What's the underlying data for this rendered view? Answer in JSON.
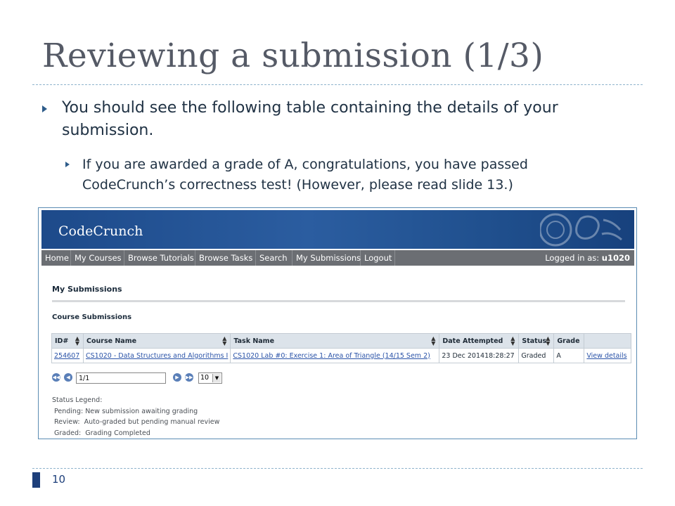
{
  "slide": {
    "title": "Reviewing a submission (1/3)",
    "bullet1": "You should see the following table containing the details of your submission.",
    "bullet2": "If you are awarded a grade of A, congratulations, you have passed CodeCrunch’s correctness test! (However, please read slide 13.)",
    "page_number": "10"
  },
  "app": {
    "logo": "CodeCrunch",
    "nav": [
      "Home",
      "My Courses",
      "Browse Tutorials",
      "Browse Tasks",
      "Search",
      "My Submissions",
      "Logout"
    ],
    "logged_in_label": "Logged in as:",
    "logged_in_user": "u1020",
    "page_heading": "My Submissions",
    "section_heading": "Course Submissions",
    "table": {
      "headers": [
        "ID#",
        "Course Name",
        "Task Name",
        "Date Attempted",
        "Status",
        "Grade",
        ""
      ],
      "rows": [
        {
          "id": "254607",
          "course": "CS1020 - Data Structures and Algorithms I",
          "task": "CS1020 Lab #0: Exercise 1: Area of Triangle (14/15 Sem 2)",
          "date": "23 Dec 201418:28:27",
          "status": "Graded",
          "grade": "A",
          "action": "View details"
        }
      ]
    },
    "pager": {
      "page_value": "1/1",
      "page_size": "10"
    },
    "legend": {
      "title": "Status Legend:",
      "items": [
        "Pending: New submission awaiting grading",
        "Review:  Auto-graded but pending manual review",
        "Graded:  Grading Completed"
      ]
    }
  }
}
